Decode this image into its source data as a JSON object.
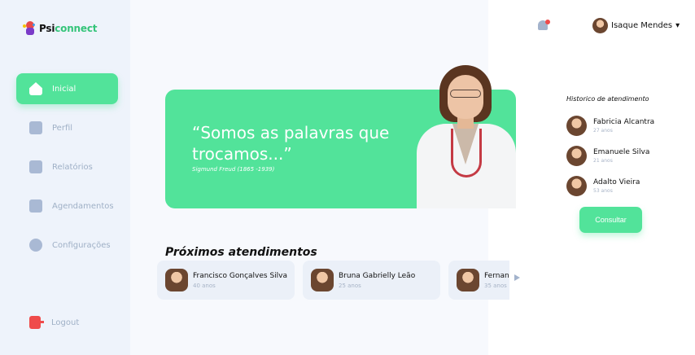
{
  "brand": {
    "psi": "Psi",
    "connect": "connect"
  },
  "sidebar": {
    "items": [
      {
        "label": "Inicial",
        "icon": "home-icon",
        "active": true
      },
      {
        "label": "Perfil",
        "icon": "profile-icon",
        "active": false
      },
      {
        "label": "Relatórios",
        "icon": "wallet-icon",
        "active": false
      },
      {
        "label": "Agendamentos",
        "icon": "chart-icon",
        "active": false
      },
      {
        "label": "Configurações",
        "icon": "gear-icon",
        "active": false
      }
    ],
    "logout": "Logout"
  },
  "header": {
    "user_name": "Isaque Mendes",
    "notification_icon": "bell-icon"
  },
  "hero": {
    "quote": "“Somos as palavras que trocamos...”",
    "author": "Sigmund Freud (1865 -1939)"
  },
  "upcoming": {
    "title": "Próximos atendimentos",
    "items": [
      {
        "name": "Francisco Gonçalves Silva",
        "age": "40 anos"
      },
      {
        "name": "Bruna Gabrielly Leão",
        "age": "25 anos"
      },
      {
        "name": "Fernanda",
        "age": "35 anos"
      }
    ]
  },
  "history": {
    "title": "Historico de atendimento",
    "items": [
      {
        "name": "Fabricia Alcantra",
        "age": "27 anos"
      },
      {
        "name": "Emanuele Silva",
        "age": "21 anos"
      },
      {
        "name": "Adalto Vieira",
        "age": "53 anos"
      }
    ],
    "button": "Consultar"
  },
  "colors": {
    "accent": "#52e39a",
    "danger": "#ef4b4b",
    "muted": "#9fb0c6"
  }
}
